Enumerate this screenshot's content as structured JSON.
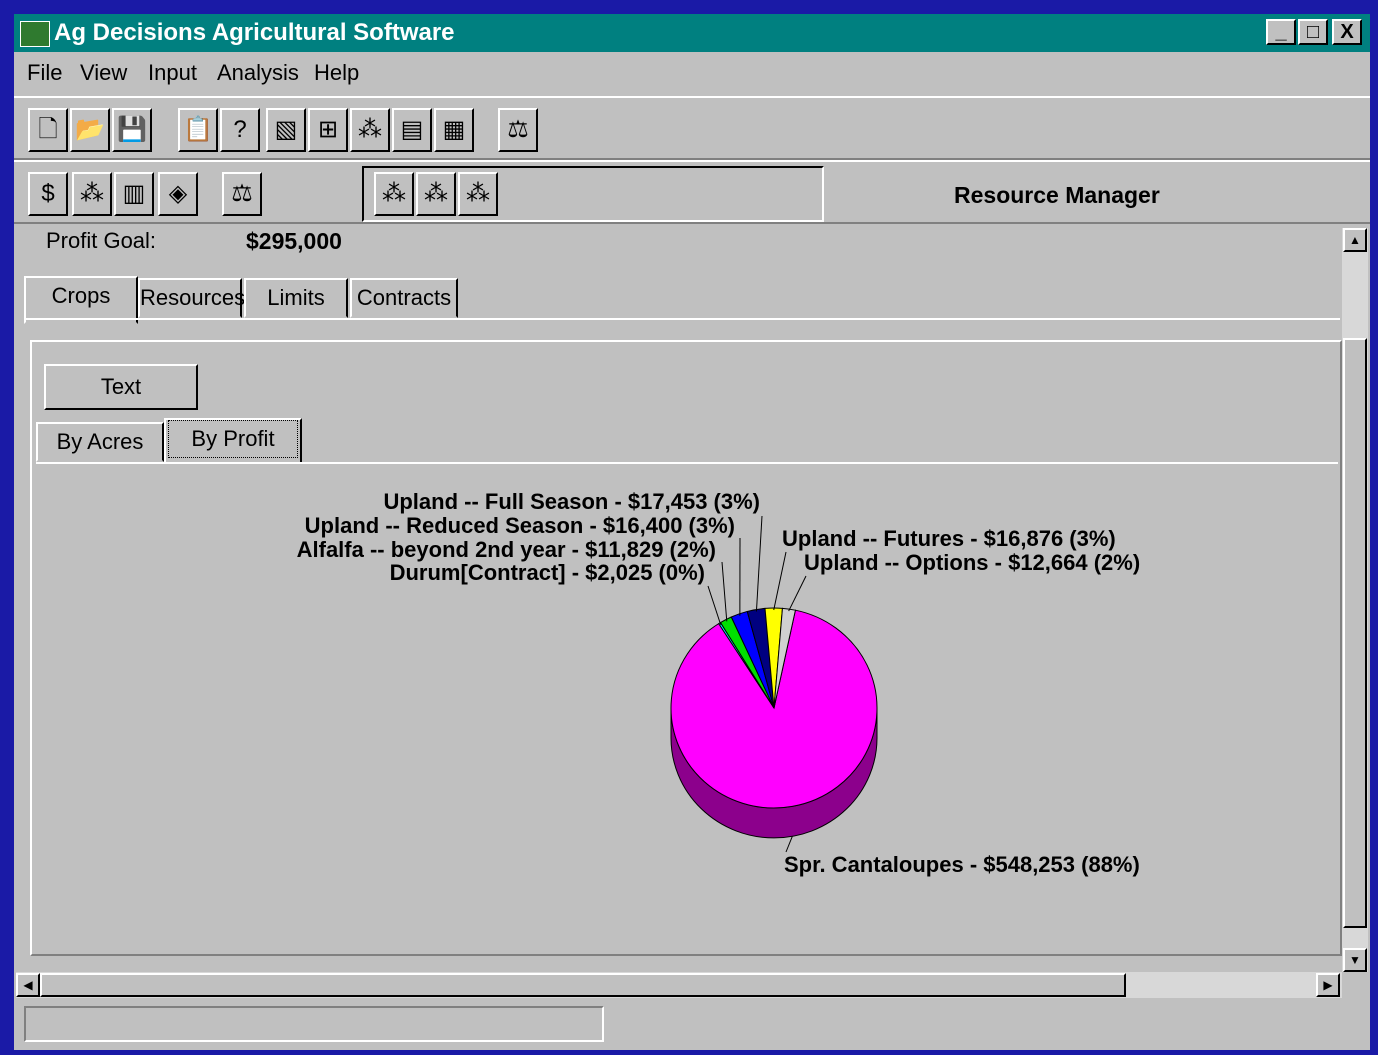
{
  "window": {
    "title": "Ag Decisions Agricultural Software",
    "controls": [
      "_",
      "□",
      "X"
    ]
  },
  "menu": [
    "File",
    "View",
    "Input",
    "Analysis",
    "Help"
  ],
  "toolbar1": {
    "icons": [
      "new-document-icon",
      "open-folder-icon",
      "save-icon",
      "report-icon",
      "help-question-icon",
      "map-icon",
      "grid-icon",
      "hierarchy-icon",
      "page-icon",
      "table-icon",
      "balance-scale-icon"
    ]
  },
  "toolbar2": {
    "icons": [
      "dollar-icon",
      "hierarchy-icon",
      "silo-icon",
      "warning-icon",
      "balance-scale-icon"
    ],
    "resource_icons": [
      "resource-add-icon",
      "resource-up-icon",
      "resource-check-icon"
    ],
    "resource_label": "Resource Manager"
  },
  "profit_goal": {
    "label": "Profit Goal:",
    "value": "$295,000"
  },
  "tabs": [
    "Crops",
    "Resources",
    "Limits",
    "Contracts"
  ],
  "active_tab": "Crops",
  "text_button": "Text",
  "subtabs": [
    "By Acres",
    "By Profit"
  ],
  "active_subtab": "By Profit",
  "chart_data": {
    "type": "pie",
    "title": "",
    "slices": [
      {
        "label": "Spr. Cantaloupes - $548,253 (88%)",
        "value": 548253,
        "color": "#ff00ff"
      },
      {
        "label": "Durum[Contract] - $2,025 (0%)",
        "value": 2025,
        "color": "#00ffff"
      },
      {
        "label": "Alfalfa -- beyond 2nd year - $11,829 (2%)",
        "value": 11829,
        "color": "#00e000"
      },
      {
        "label": "Upland -- Reduced Season - $16,400 (3%)",
        "value": 16400,
        "color": "#0000ff"
      },
      {
        "label": "Upland -- Full Season - $17,453 (3%)",
        "value": 17453,
        "color": "#000080"
      },
      {
        "label": "Upland -- Futures - $16,876 (3%)",
        "value": 16876,
        "color": "#ffff00"
      },
      {
        "label": "Upland -- Options - $12,664 (2%)",
        "value": 12664,
        "color": "#d0d0d0"
      }
    ]
  }
}
